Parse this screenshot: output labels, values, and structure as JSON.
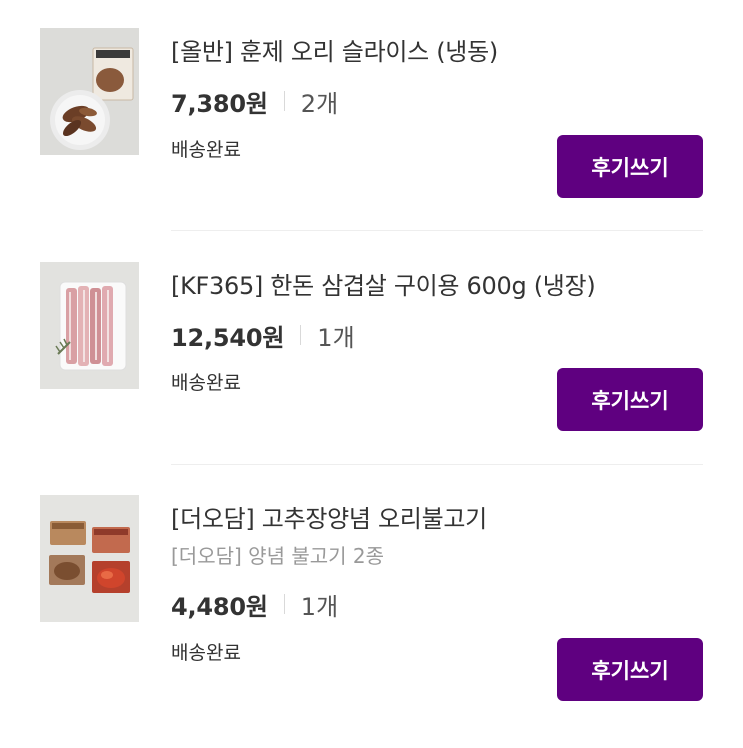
{
  "orders": [
    {
      "title": "[올반] 훈제 오리 슬라이스 (냉동)",
      "price": "7,380원",
      "quantity": "2개",
      "status": "배송완료",
      "review_label": "후기쓰기",
      "thumbnail_icon": "smoked-duck-slices-photo"
    },
    {
      "title": "[KF365] 한돈 삼겹살 구이용 600g (냉장)",
      "price": "12,540원",
      "quantity": "1개",
      "status": "배송완료",
      "review_label": "후기쓰기",
      "thumbnail_icon": "pork-belly-tray-photo"
    },
    {
      "title": "[더오담] 고추장양념 오리불고기",
      "subtitle": "[더오담] 양념 불고기 2종",
      "price": "4,480원",
      "quantity": "1개",
      "status": "배송완료",
      "review_label": "후기쓰기",
      "thumbnail_icon": "bulgogi-packages-photo"
    }
  ],
  "colors": {
    "button": "#5f0080",
    "button_text": "#ffffff",
    "subtitle": "#999999"
  }
}
